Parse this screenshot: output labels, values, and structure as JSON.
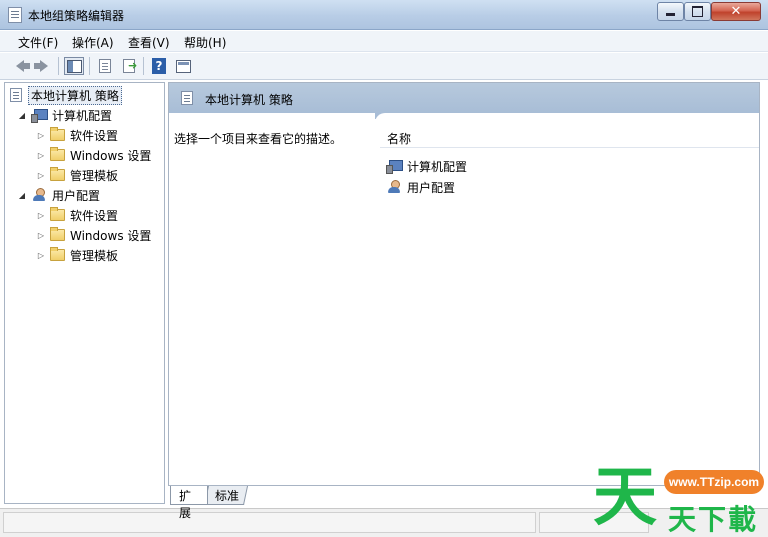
{
  "window": {
    "title": "本地组策略编辑器",
    "close_glyph": "✕"
  },
  "menubar": [
    {
      "label": "文件(F)"
    },
    {
      "label": "操作(A)"
    },
    {
      "label": "查看(V)"
    },
    {
      "label": "帮助(H)"
    }
  ],
  "toolbar": {
    "help_glyph": "?"
  },
  "tree": {
    "root": "本地计算机 策略",
    "computer_config": "计算机配置",
    "computer_children": [
      "软件设置",
      "Windows 设置",
      "管理模板"
    ],
    "user_config": "用户配置",
    "user_children": [
      "软件设置",
      "Windows 设置",
      "管理模板"
    ],
    "expander_open": "◢",
    "expander_closed": "▷"
  },
  "right_pane": {
    "header_title": "本地计算机 策略",
    "description": "选择一个项目来查看它的描述。",
    "column_name": "名称",
    "items": [
      "计算机配置",
      "用户配置"
    ]
  },
  "tabs": [
    {
      "label": "扩展",
      "active": true
    },
    {
      "label": "标准",
      "active": false
    }
  ],
  "watermark": {
    "big_char": "天",
    "url": "www.TTzip.com",
    "small_text": "天下載",
    "color_green": "#1fb64a",
    "color_orange": "#f0812a"
  }
}
